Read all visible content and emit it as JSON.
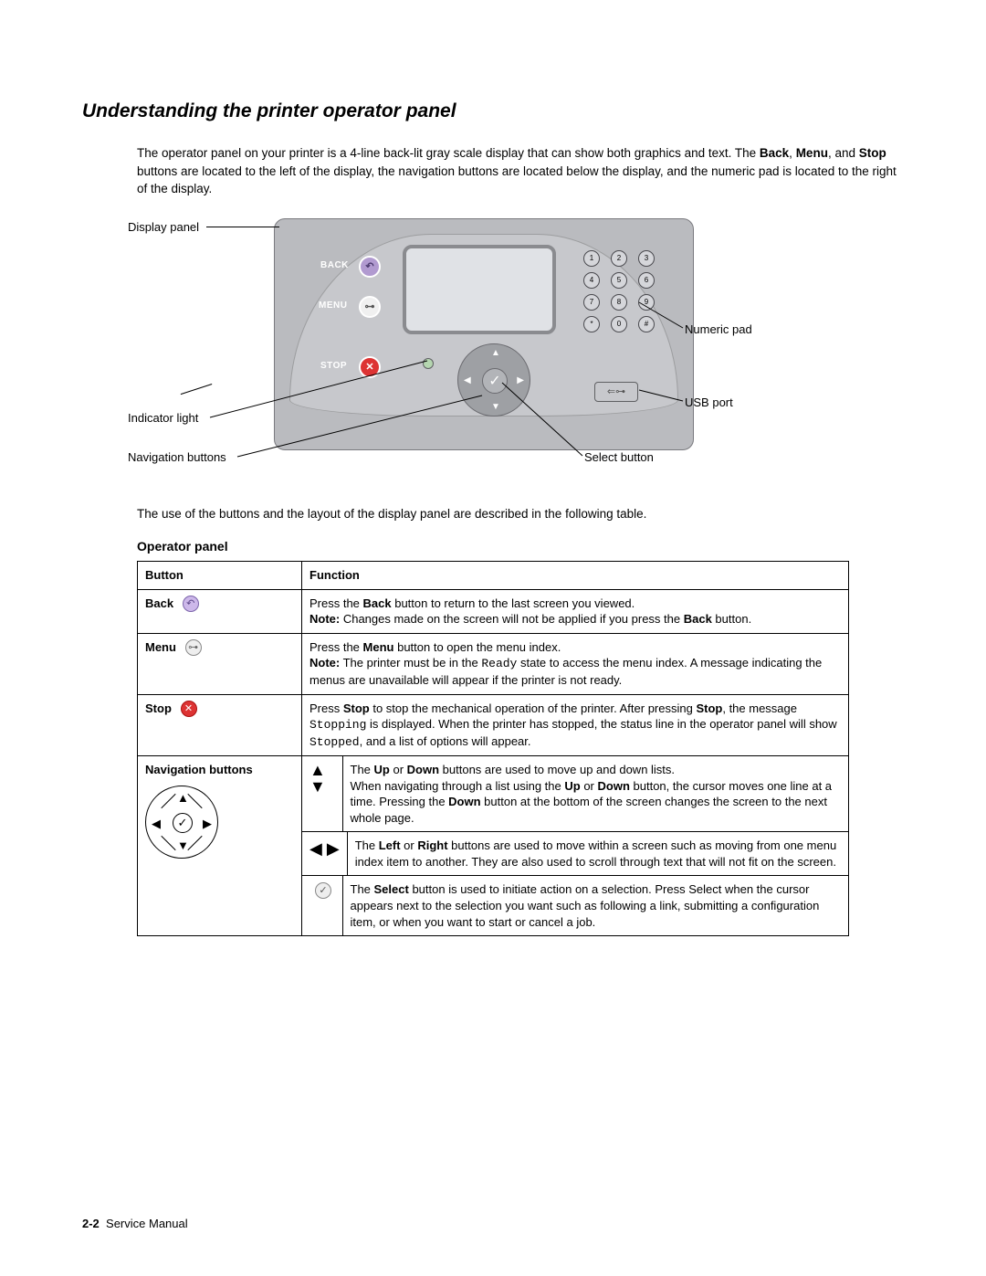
{
  "title": "Understanding the printer operator panel",
  "intro_html": "The operator panel on your printer is a 4-line back-lit gray scale display that can show both graphics and text. The <b>Back</b>, <b>Menu</b>, and <b>Stop</b> buttons are located to the left of the display, the navigation buttons are located below the display, and the numeric pad is located to the right of the display.",
  "diagram": {
    "callouts": {
      "display_panel": "Display panel",
      "indicator_light": "Indicator light",
      "navigation_buttons": "Navigation buttons",
      "numeric_pad": "Numeric pad",
      "usb_port": "USB port",
      "select_button": "Select button"
    },
    "labels": {
      "back": "BACK",
      "menu": "MENU",
      "stop": "STOP"
    },
    "keypad": [
      "1",
      "2",
      "3",
      "4",
      "5",
      "6",
      "7",
      "8",
      "9",
      "*",
      "0",
      "#"
    ]
  },
  "below_intro": "The use of the buttons and the layout of the display panel are described in the following table.",
  "table_title": "Operator panel",
  "table": {
    "headers": {
      "button": "Button",
      "function": "Function"
    },
    "rows": {
      "back": {
        "label": "Back",
        "function_html": "Press the <b>Back</b> button to return to the last screen you viewed.<br><b>Note:</b> Changes made on the screen will not be applied if you press the <b>Back</b> button."
      },
      "menu": {
        "label": "Menu",
        "function_html": "Press the <b>Menu</b> button to open the menu index.<br><b>Note:</b> The printer must be in the <span class=\"mono\">Ready</span> state to access the menu index. A message indicating the menus are unavailable will appear if the printer is not ready."
      },
      "stop": {
        "label": "Stop",
        "function_html": "Press <b>Stop</b> to stop the mechanical operation of the printer. After pressing <b>Stop</b>, the message <span class=\"mono\">Stopping</span> is displayed. When the printer has stopped, the status line in the operator panel will show <span class=\"mono\">Stopped</span>, and a list of options will appear."
      },
      "nav": {
        "label": "Navigation buttons",
        "updown_html": "The <b>Up</b> or <b>Down</b> buttons are used to move up and down lists.<br>When navigating through a list using the <b>Up</b> or <b>Down</b> button, the cursor moves one line at a time. Pressing the <b>Down</b> button at the bottom of the screen changes the screen to the next whole page.",
        "leftright_html": "The <b>Left</b> or <b>Right</b> buttons are used to move within a screen such as moving from one menu index item to another. They are also used to scroll through text that will not fit on the screen.",
        "select_html": "The <b>Select</b> button is used to initiate action on a selection. Press Select when the cursor appears next to the selection you want such as following a link, submitting a configuration item, or when you want to start or cancel a job."
      }
    }
  },
  "footer": {
    "page": "2-2",
    "manual": "Service Manual"
  }
}
